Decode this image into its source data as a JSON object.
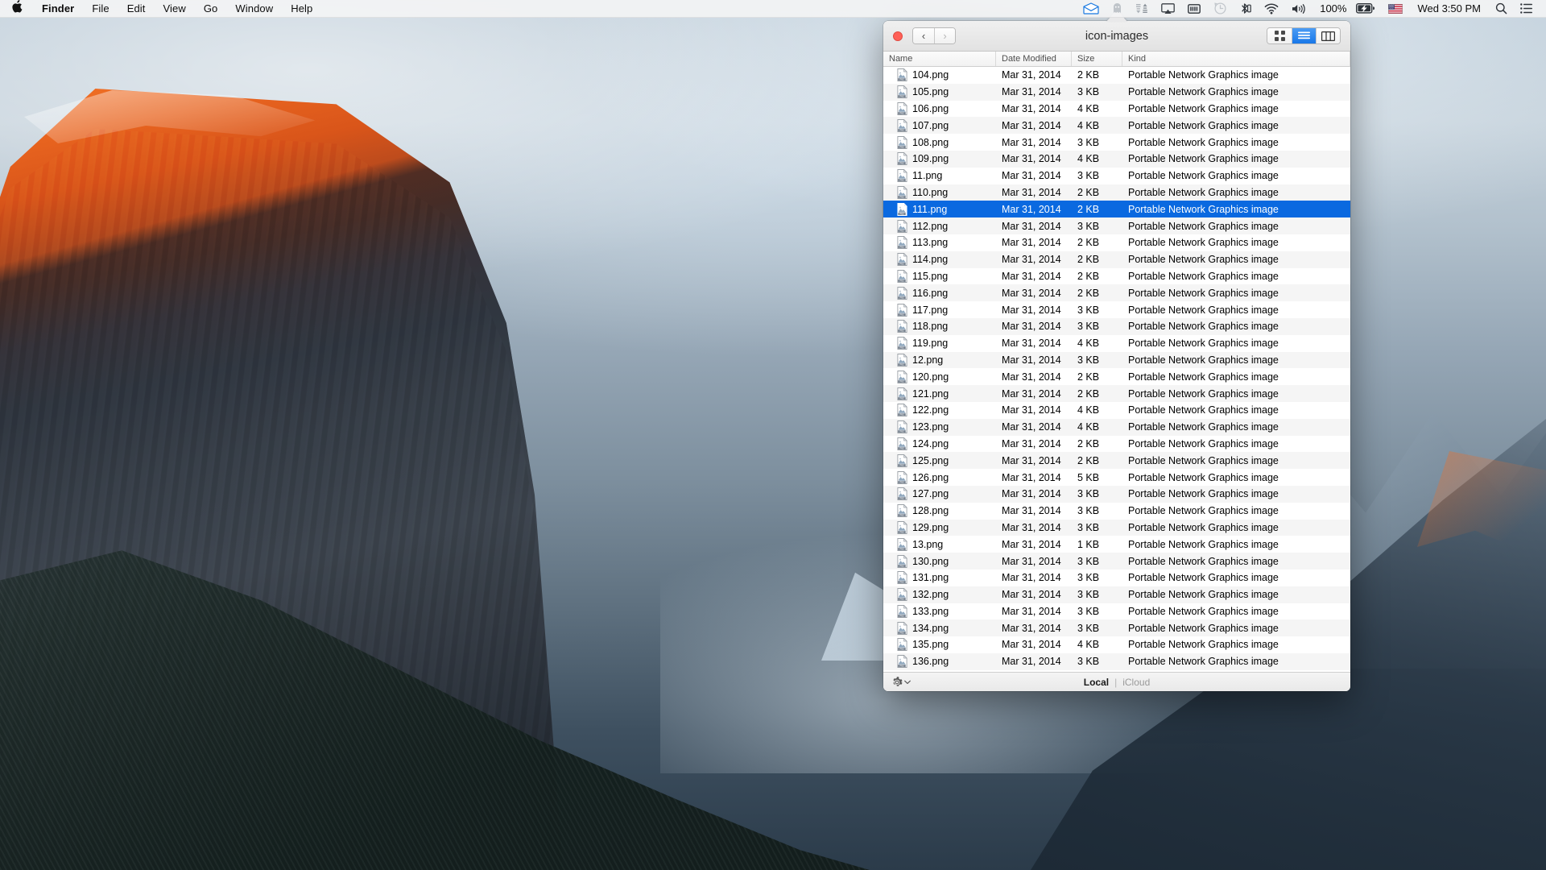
{
  "menubar": {
    "apple_icon": "apple-logo-icon",
    "app_name": "Finder",
    "items": [
      "File",
      "Edit",
      "View",
      "Go",
      "Window",
      "Help"
    ],
    "status_icons": [
      "dropbox-icon",
      "ghost-icon",
      "transfer-arrows-icon",
      "airplay-icon",
      "battery-status-icon",
      "time-machine-icon",
      "bluetooth-icon",
      "wifi-icon",
      "volume-icon"
    ],
    "battery_percent": "100%",
    "battery_icon": "battery-charging-icon",
    "input_flag": "us-flag-icon",
    "clock": "Wed 3:50 PM",
    "search_icon": "search-icon",
    "notification_icon": "notification-center-icon"
  },
  "window": {
    "title": "icon-images",
    "close_button": "close-window-button",
    "nav_back": "‹",
    "nav_forward": "›",
    "view_modes": [
      {
        "name": "icon-view",
        "active": false
      },
      {
        "name": "list-view",
        "active": true
      },
      {
        "name": "column-view",
        "active": false
      }
    ],
    "accent_color": "#0a69e0",
    "columns": [
      "Name",
      "Date Modified",
      "Size",
      "Kind"
    ],
    "files": [
      {
        "name": "104.png",
        "date": "Mar 31, 2014",
        "size": "2 KB",
        "kind": "Portable Network Graphics image",
        "selected": false
      },
      {
        "name": "105.png",
        "date": "Mar 31, 2014",
        "size": "3 KB",
        "kind": "Portable Network Graphics image",
        "selected": false
      },
      {
        "name": "106.png",
        "date": "Mar 31, 2014",
        "size": "4 KB",
        "kind": "Portable Network Graphics image",
        "selected": false
      },
      {
        "name": "107.png",
        "date": "Mar 31, 2014",
        "size": "4 KB",
        "kind": "Portable Network Graphics image",
        "selected": false
      },
      {
        "name": "108.png",
        "date": "Mar 31, 2014",
        "size": "3 KB",
        "kind": "Portable Network Graphics image",
        "selected": false
      },
      {
        "name": "109.png",
        "date": "Mar 31, 2014",
        "size": "4 KB",
        "kind": "Portable Network Graphics image",
        "selected": false
      },
      {
        "name": "11.png",
        "date": "Mar 31, 2014",
        "size": "3 KB",
        "kind": "Portable Network Graphics image",
        "selected": false
      },
      {
        "name": "110.png",
        "date": "Mar 31, 2014",
        "size": "2 KB",
        "kind": "Portable Network Graphics image",
        "selected": false
      },
      {
        "name": "111.png",
        "date": "Mar 31, 2014",
        "size": "2 KB",
        "kind": "Portable Network Graphics image",
        "selected": true
      },
      {
        "name": "112.png",
        "date": "Mar 31, 2014",
        "size": "3 KB",
        "kind": "Portable Network Graphics image",
        "selected": false
      },
      {
        "name": "113.png",
        "date": "Mar 31, 2014",
        "size": "2 KB",
        "kind": "Portable Network Graphics image",
        "selected": false
      },
      {
        "name": "114.png",
        "date": "Mar 31, 2014",
        "size": "2 KB",
        "kind": "Portable Network Graphics image",
        "selected": false
      },
      {
        "name": "115.png",
        "date": "Mar 31, 2014",
        "size": "2 KB",
        "kind": "Portable Network Graphics image",
        "selected": false
      },
      {
        "name": "116.png",
        "date": "Mar 31, 2014",
        "size": "2 KB",
        "kind": "Portable Network Graphics image",
        "selected": false
      },
      {
        "name": "117.png",
        "date": "Mar 31, 2014",
        "size": "3 KB",
        "kind": "Portable Network Graphics image",
        "selected": false
      },
      {
        "name": "118.png",
        "date": "Mar 31, 2014",
        "size": "3 KB",
        "kind": "Portable Network Graphics image",
        "selected": false
      },
      {
        "name": "119.png",
        "date": "Mar 31, 2014",
        "size": "4 KB",
        "kind": "Portable Network Graphics image",
        "selected": false
      },
      {
        "name": "12.png",
        "date": "Mar 31, 2014",
        "size": "3 KB",
        "kind": "Portable Network Graphics image",
        "selected": false
      },
      {
        "name": "120.png",
        "date": "Mar 31, 2014",
        "size": "2 KB",
        "kind": "Portable Network Graphics image",
        "selected": false
      },
      {
        "name": "121.png",
        "date": "Mar 31, 2014",
        "size": "2 KB",
        "kind": "Portable Network Graphics image",
        "selected": false
      },
      {
        "name": "122.png",
        "date": "Mar 31, 2014",
        "size": "4 KB",
        "kind": "Portable Network Graphics image",
        "selected": false
      },
      {
        "name": "123.png",
        "date": "Mar 31, 2014",
        "size": "4 KB",
        "kind": "Portable Network Graphics image",
        "selected": false
      },
      {
        "name": "124.png",
        "date": "Mar 31, 2014",
        "size": "2 KB",
        "kind": "Portable Network Graphics image",
        "selected": false
      },
      {
        "name": "125.png",
        "date": "Mar 31, 2014",
        "size": "2 KB",
        "kind": "Portable Network Graphics image",
        "selected": false
      },
      {
        "name": "126.png",
        "date": "Mar 31, 2014",
        "size": "5 KB",
        "kind": "Portable Network Graphics image",
        "selected": false
      },
      {
        "name": "127.png",
        "date": "Mar 31, 2014",
        "size": "3 KB",
        "kind": "Portable Network Graphics image",
        "selected": false
      },
      {
        "name": "128.png",
        "date": "Mar 31, 2014",
        "size": "3 KB",
        "kind": "Portable Network Graphics image",
        "selected": false
      },
      {
        "name": "129.png",
        "date": "Mar 31, 2014",
        "size": "3 KB",
        "kind": "Portable Network Graphics image",
        "selected": false
      },
      {
        "name": "13.png",
        "date": "Mar 31, 2014",
        "size": "1 KB",
        "kind": "Portable Network Graphics image",
        "selected": false
      },
      {
        "name": "130.png",
        "date": "Mar 31, 2014",
        "size": "3 KB",
        "kind": "Portable Network Graphics image",
        "selected": false
      },
      {
        "name": "131.png",
        "date": "Mar 31, 2014",
        "size": "3 KB",
        "kind": "Portable Network Graphics image",
        "selected": false
      },
      {
        "name": "132.png",
        "date": "Mar 31, 2014",
        "size": "3 KB",
        "kind": "Portable Network Graphics image",
        "selected": false
      },
      {
        "name": "133.png",
        "date": "Mar 31, 2014",
        "size": "3 KB",
        "kind": "Portable Network Graphics image",
        "selected": false
      },
      {
        "name": "134.png",
        "date": "Mar 31, 2014",
        "size": "3 KB",
        "kind": "Portable Network Graphics image",
        "selected": false
      },
      {
        "name": "135.png",
        "date": "Mar 31, 2014",
        "size": "4 KB",
        "kind": "Portable Network Graphics image",
        "selected": false
      },
      {
        "name": "136.png",
        "date": "Mar 31, 2014",
        "size": "3 KB",
        "kind": "Portable Network Graphics image",
        "selected": false
      }
    ],
    "statusbar": {
      "gear_icon": "settings-gear-icon",
      "local_label": "Local",
      "separator": "|",
      "icloud_label": "iCloud"
    }
  }
}
